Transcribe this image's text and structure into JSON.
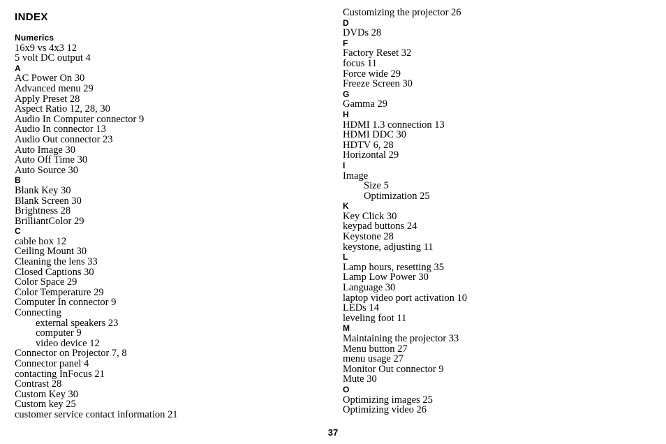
{
  "page": {
    "title": "INDEX",
    "page_number": "37"
  },
  "columns": [
    {
      "name": "left",
      "blocks": [
        {
          "type": "section",
          "label": "Numerics"
        },
        {
          "type": "entry",
          "label": "16x9 vs 4x3 12"
        },
        {
          "type": "entry",
          "label": "5 volt DC output 4"
        },
        {
          "type": "section",
          "label": "A"
        },
        {
          "type": "entry",
          "label": "AC Power On 30"
        },
        {
          "type": "entry",
          "label": "Advanced menu 29"
        },
        {
          "type": "entry",
          "label": "Apply Preset 28"
        },
        {
          "type": "entry",
          "label": "Aspect Ratio 12, 28, 30"
        },
        {
          "type": "entry",
          "label": "Audio In Computer connector 9"
        },
        {
          "type": "entry",
          "label": "Audio In connector 13"
        },
        {
          "type": "entry",
          "label": "Audio Out connector 23"
        },
        {
          "type": "entry",
          "label": "Auto Image 30"
        },
        {
          "type": "entry",
          "label": "Auto Off Time 30"
        },
        {
          "type": "entry",
          "label": "Auto Source 30"
        },
        {
          "type": "section",
          "label": "B"
        },
        {
          "type": "entry",
          "label": "Blank Key 30"
        },
        {
          "type": "entry",
          "label": "Blank Screen 30"
        },
        {
          "type": "entry",
          "label": "Brightness 28"
        },
        {
          "type": "entry",
          "label": "BrilliantColor 29"
        },
        {
          "type": "section",
          "label": "C"
        },
        {
          "type": "entry",
          "label": "cable box 12"
        },
        {
          "type": "entry",
          "label": "Ceiling Mount 30"
        },
        {
          "type": "entry",
          "label": "Cleaning the lens 33"
        },
        {
          "type": "entry",
          "label": "Closed Captions 30"
        },
        {
          "type": "entry",
          "label": "Color Space 29"
        },
        {
          "type": "entry",
          "label": "Color Temperature 29"
        },
        {
          "type": "entry",
          "label": "Computer In connector 9"
        },
        {
          "type": "entry",
          "label": "Connecting"
        },
        {
          "type": "subentry",
          "label": "external speakers 23"
        },
        {
          "type": "subentry",
          "label": "computer 9"
        },
        {
          "type": "subentry",
          "label": "video device 12"
        },
        {
          "type": "entry",
          "label": "Connector on Projector 7, 8"
        },
        {
          "type": "entry",
          "label": "Connector panel 4"
        },
        {
          "type": "entry",
          "label": "contacting InFocus 21"
        },
        {
          "type": "entry",
          "label": "Contrast 28"
        },
        {
          "type": "entry",
          "label": "Custom Key 30"
        },
        {
          "type": "entry",
          "label": "Custom key 25"
        },
        {
          "type": "entry",
          "label": "customer service contact information 21"
        }
      ]
    },
    {
      "name": "right",
      "blocks": [
        {
          "type": "entry",
          "label": "Customizing the projector 26"
        },
        {
          "type": "section",
          "label": "D"
        },
        {
          "type": "entry",
          "label": "DVDs 28"
        },
        {
          "type": "section",
          "label": "F"
        },
        {
          "type": "entry",
          "label": "Factory Reset 32"
        },
        {
          "type": "entry",
          "label": "focus 11"
        },
        {
          "type": "entry",
          "label": "Force wide 29"
        },
        {
          "type": "entry",
          "label": "Freeze Screen 30"
        },
        {
          "type": "section",
          "label": "G"
        },
        {
          "type": "entry",
          "label": "Gamma 29"
        },
        {
          "type": "section",
          "label": "H"
        },
        {
          "type": "entry",
          "label": "HDMI 1.3 connection 13"
        },
        {
          "type": "entry",
          "label": "HDMI DDC 30"
        },
        {
          "type": "entry",
          "label": "HDTV 6, 28"
        },
        {
          "type": "entry",
          "label": "Horizontal 29"
        },
        {
          "type": "section",
          "label": "I"
        },
        {
          "type": "entry",
          "label": "Image"
        },
        {
          "type": "subentry",
          "label": "Size 5"
        },
        {
          "type": "subentry",
          "label": "Optimization 25"
        },
        {
          "type": "section",
          "label": "K"
        },
        {
          "type": "entry",
          "label": "Key Click 30"
        },
        {
          "type": "entry",
          "label": "keypad buttons 24"
        },
        {
          "type": "entry",
          "label": "Keystone 28"
        },
        {
          "type": "entry",
          "label": "keystone, adjusting 11"
        },
        {
          "type": "section",
          "label": "L"
        },
        {
          "type": "entry",
          "label": "Lamp hours, resetting 35"
        },
        {
          "type": "entry",
          "label": "Lamp Low Power 30"
        },
        {
          "type": "entry",
          "label": "Language 30"
        },
        {
          "type": "entry",
          "label": "laptop video port activation 10"
        },
        {
          "type": "entry",
          "label": "LEDs 14"
        },
        {
          "type": "entry",
          "label": "leveling foot 11"
        },
        {
          "type": "section",
          "label": "M"
        },
        {
          "type": "entry",
          "label": "Maintaining the projector 33"
        },
        {
          "type": "entry",
          "label": "Menu button 27"
        },
        {
          "type": "entry",
          "label": "menu usage 27"
        },
        {
          "type": "entry",
          "label": "Monitor Out connector 9"
        },
        {
          "type": "entry",
          "label": "Mute 30"
        },
        {
          "type": "section",
          "label": "O"
        },
        {
          "type": "entry",
          "label": "Optimizing images 25"
        },
        {
          "type": "entry",
          "label": "Optimizing video 26"
        }
      ]
    }
  ]
}
